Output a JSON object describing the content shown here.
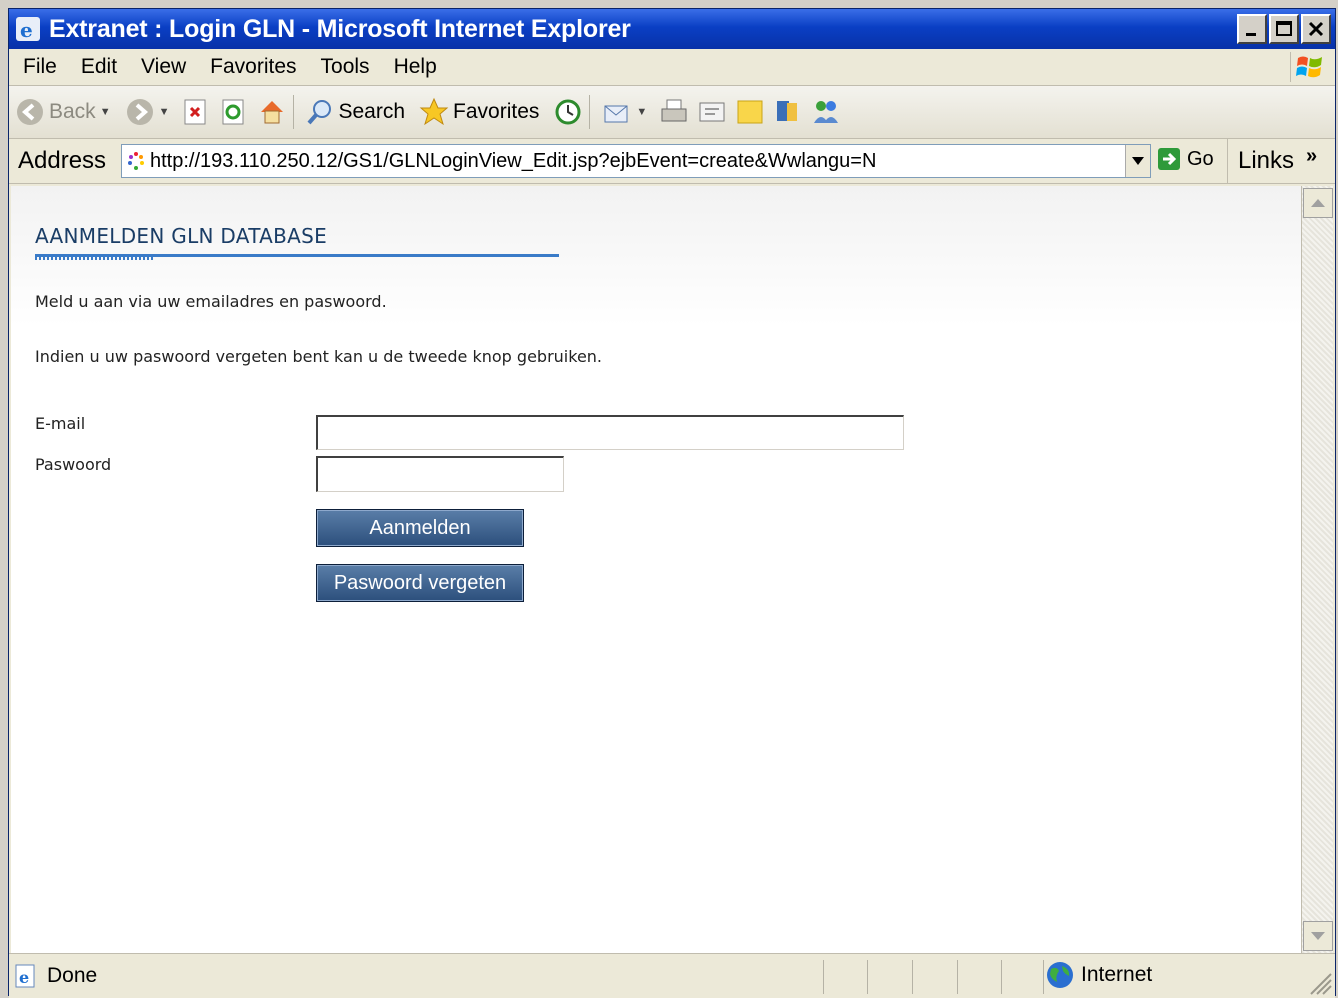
{
  "window": {
    "title": "Extranet : Login GLN - Microsoft Internet Explorer",
    "buttons": {
      "minimize": "_",
      "maximize": "□",
      "close": "X"
    }
  },
  "menu": [
    "File",
    "Edit",
    "View",
    "Favorites",
    "Tools",
    "Help"
  ],
  "toolbar": {
    "back_label": "Back",
    "search_label": "Search",
    "favorites_label": "Favorites"
  },
  "address": {
    "label": "Address",
    "url": "http://193.110.250.12/GS1/GLNLoginView_Edit.jsp?ejbEvent=create&Wwlangu=N",
    "go_label": "Go",
    "links_label": "Links",
    "links_more": "»"
  },
  "page": {
    "heading": "AANMELDEN GLN DATABASE",
    "intro_line1": "Meld u aan via uw emailadres en paswoord.",
    "intro_line2": "Indien u uw paswoord vergeten bent kan u de tweede knop gebruiken.",
    "form": {
      "email_label": "E-mail",
      "email_value": "",
      "password_label": "Paswoord",
      "password_value": "",
      "login_button": "Aanmelden",
      "forgot_button": "Paswoord vergeten"
    }
  },
  "status": {
    "text": "Done",
    "zone": "Internet"
  },
  "colors": {
    "titlebar": "#0a3fc4",
    "heading": "#1a3d66",
    "heading_rule": "#3a7bc8",
    "button": "#2c4f7c"
  }
}
